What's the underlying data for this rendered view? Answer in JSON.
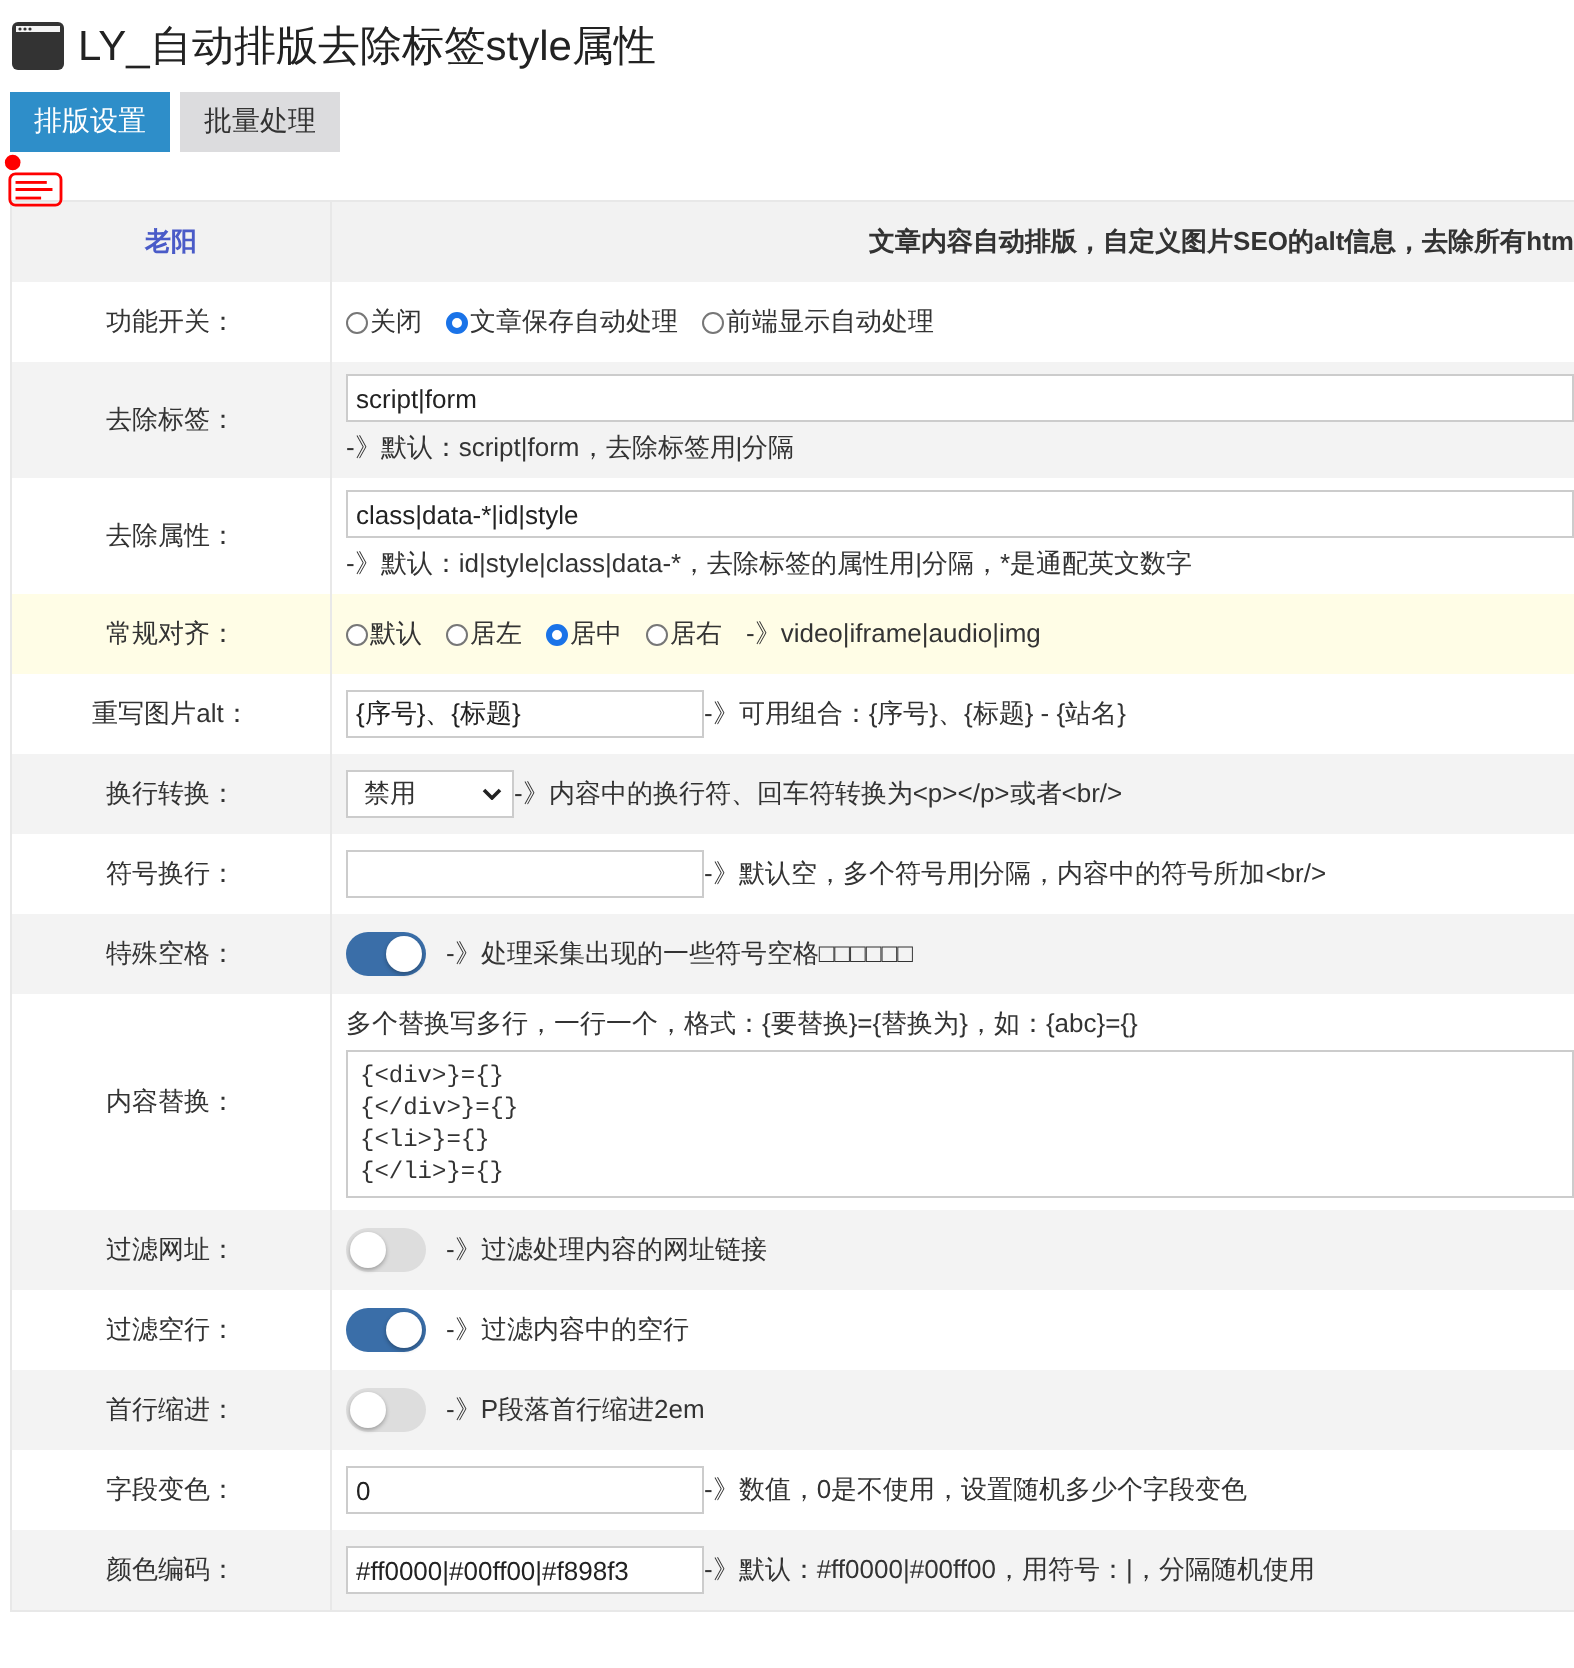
{
  "page": {
    "title": "LY_自动排版去除标签style属性"
  },
  "tabs": [
    {
      "label": "排版设置",
      "selected": true
    },
    {
      "label": "批量处理",
      "selected": false
    }
  ],
  "table": {
    "header": {
      "column_1": "老阳",
      "column_2": "文章内容自动排版，自定义图片SEO的alt信息，去除所有htm"
    },
    "rows": [
      {
        "label": "功能开关：",
        "kind": "radio",
        "highlighted": false,
        "options": [
          {
            "label": "关闭",
            "selected": false
          },
          {
            "label": "文章保存自动处理",
            "selected": true
          },
          {
            "label": "前端显示自动处理",
            "selected": false
          }
        ]
      },
      {
        "label": "去除标签：",
        "kind": "input_hint",
        "highlighted": false,
        "value": "script|form",
        "hint": "-》默认：script|form，去除标签用|分隔"
      },
      {
        "label": "去除属性：",
        "kind": "input_hint",
        "highlighted": false,
        "value": "class|data-*|id|style",
        "hint": "-》默认：id|style|class|data-*，去除标签的属性用|分隔，*是通配英文数字"
      },
      {
        "label": "常规对齐：",
        "kind": "radio",
        "highlighted": true,
        "options": [
          {
            "label": "默认",
            "selected": false
          },
          {
            "label": "居左",
            "selected": false
          },
          {
            "label": "居中",
            "selected": true
          },
          {
            "label": "居右",
            "selected": false
          }
        ],
        "note": "-》video|iframe|audio|img"
      },
      {
        "label": "重写图片alt：",
        "kind": "input_note",
        "highlighted": false,
        "value": "{序号}、{标题}",
        "note": "-》可用组合：{序号}、{标题} - {站名}"
      },
      {
        "label": "换行转换：",
        "kind": "select",
        "highlighted": false,
        "value": "禁用",
        "note": "-》内容中的换行符、回车符转换为<p></p>或者<br/>"
      },
      {
        "label": "符号换行：",
        "kind": "input_note",
        "highlighted": false,
        "note": "-》默认空，多个符号用|分隔，内容中的符号所加<br/>"
      },
      {
        "label": "特殊空格：",
        "kind": "toggle",
        "highlighted": false,
        "on": true,
        "note": "-》处理采集出现的一些符号空格□□□□□□"
      },
      {
        "label": "内容替换：",
        "kind": "textarea",
        "highlighted": false,
        "hint": "多个替换写多行，一行一个，格式：{要替换}={替换为}，如：{abc}={}",
        "lines": [
          "{<div>}={}",
          "{</div>}={}",
          "{<li>}={}",
          "{</li>}={}"
        ]
      },
      {
        "label": "过滤网址：",
        "kind": "toggle",
        "highlighted": false,
        "on": false,
        "note": "-》过滤处理内容的网址链接"
      },
      {
        "label": "过滤空行：",
        "kind": "toggle",
        "highlighted": false,
        "on": true,
        "note": "-》过滤内容中的空行"
      },
      {
        "label": "首行缩进：",
        "kind": "toggle",
        "highlighted": false,
        "on": false,
        "note": "-》P段落首行缩进2em"
      },
      {
        "label": "字段变色：",
        "kind": "input_note",
        "highlighted": false,
        "value": "0",
        "note": "-》数值，0是不使用，设置随机多少个字段变色"
      },
      {
        "label": "颜色编码：",
        "kind": "input_note",
        "highlighted": false,
        "value": "#ff0000|#00ff00|#f898f3",
        "note": "-》默认：#ff0000|#00ff00，用符号：|，分隔随机使用"
      }
    ]
  }
}
